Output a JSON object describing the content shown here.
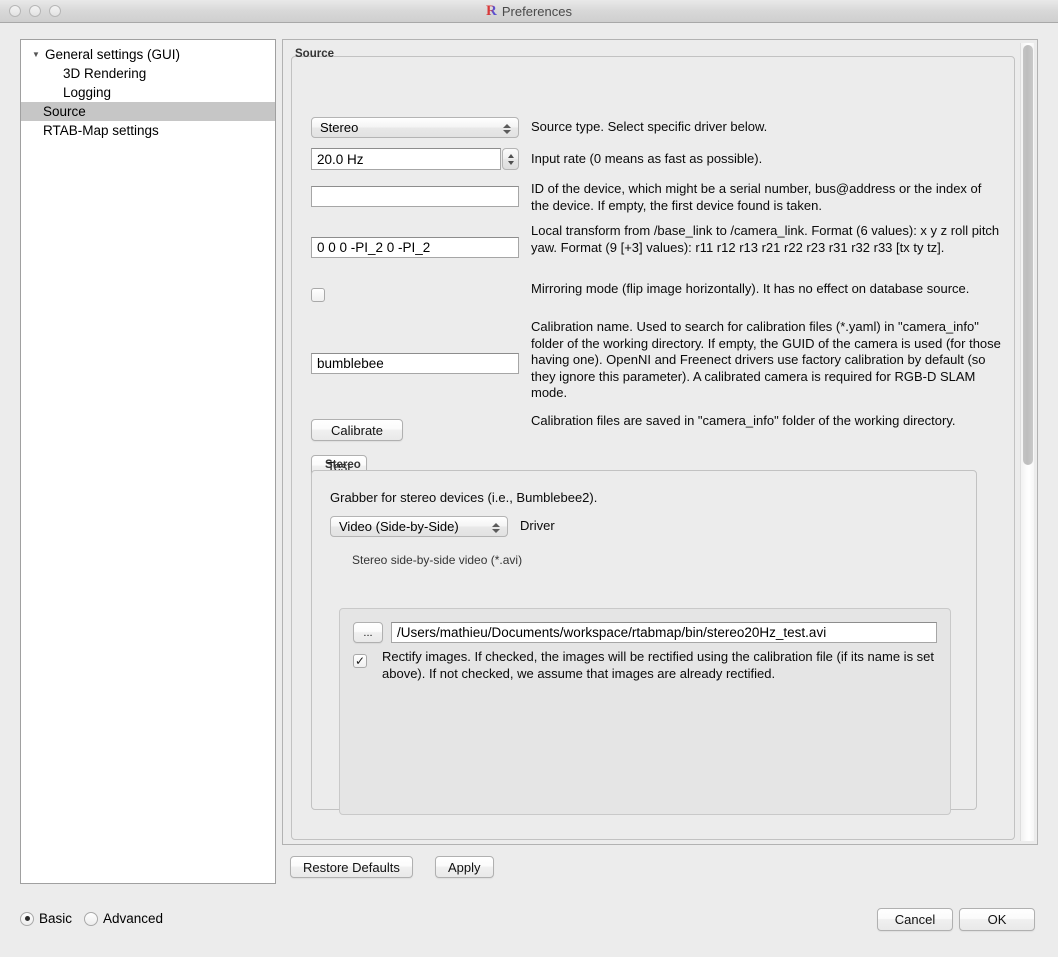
{
  "window": {
    "title": "Preferences",
    "logo_letter": "R",
    "traffic_lights": [
      "close",
      "minimize",
      "zoom"
    ]
  },
  "sidebar": {
    "items": [
      {
        "label": "General settings (GUI)",
        "level": 0,
        "expanded": true,
        "selected": false
      },
      {
        "label": "3D Rendering",
        "level": 1,
        "selected": false
      },
      {
        "label": "Logging",
        "level": 1,
        "selected": false
      },
      {
        "label": "Source",
        "level": 0,
        "selected": true
      },
      {
        "label": "RTAB-Map settings",
        "level": 0,
        "selected": false
      }
    ]
  },
  "source_group": {
    "title": "Source",
    "source_type": {
      "value": "Stereo",
      "description": "Source type. Select specific driver below."
    },
    "input_rate": {
      "value": "20.0 Hz",
      "description": "Input rate (0 means as fast as possible)."
    },
    "device_id": {
      "value": "",
      "placeholder": "",
      "description": "ID of the device, which might be a serial number, bus@address or the index of the device. If empty, the first device found is taken."
    },
    "local_transform": {
      "value": "0 0 0 -PI_2 0 -PI_2",
      "description": "Local transform from /base_link to /camera_link. Format (6 values): x y z roll pitch yaw. Format (9 [+3] values): r11 r12 r13 r21 r22 r23 r31 r32 r33 [tx ty tz]."
    },
    "mirroring": {
      "checked": false,
      "description": "Mirroring mode (flip image horizontally). It has no effect on database source."
    },
    "calibration_name": {
      "value": "bumblebee",
      "description": "Calibration name. Used to search for calibration files (*.yaml) in \"camera_info\" folder of the working directory. If empty, the GUID of the camera is used (for those having one). OpenNI and Freenect drivers use factory calibration by default (so they ignore this parameter). A calibrated camera is required for RGB-D SLAM mode."
    },
    "calibrate_button": {
      "label": "Calibrate",
      "description": "Calibration files are saved in \"camera_info\" folder of the working directory."
    },
    "test_button": {
      "label": "Test"
    }
  },
  "stereo_group": {
    "title": "Stereo",
    "intro": "Grabber for stereo devices (i.e., Bumblebee2).",
    "driver": {
      "value": "Video (Side-by-Side)",
      "label": "Driver"
    },
    "video_panel": {
      "title": "Stereo side-by-side video (*.avi)",
      "browse_button": "...",
      "path": "/Users/mathieu/Documents/workspace/rtabmap/bin/stereo20Hz_test.avi",
      "rectify": {
        "checked": true,
        "check_glyph": "✓",
        "description": "Rectify images. If checked, the images will be rectified using the calibration file (if its name is set above). If not checked, we assume that images are already rectified."
      }
    }
  },
  "footer": {
    "restore_defaults": "Restore Defaults",
    "apply": "Apply",
    "mode": {
      "basic": "Basic",
      "advanced": "Advanced",
      "selected": "Basic"
    },
    "cancel": "Cancel",
    "ok": "OK"
  },
  "colors": {
    "window_bg": "#ececec",
    "panel_bg": "#ffffff",
    "selection": "#c6c6c6",
    "border": "#b2b2b2"
  }
}
